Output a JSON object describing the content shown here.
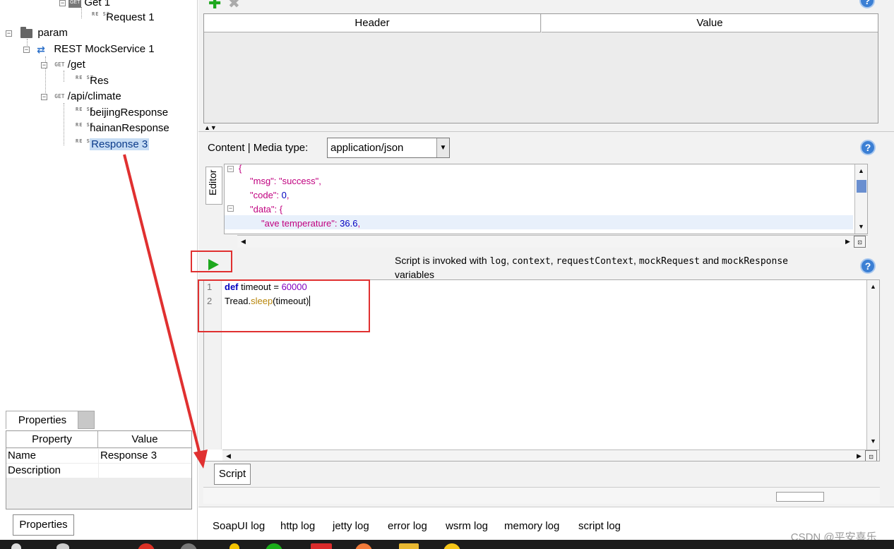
{
  "tree": {
    "get1": "Get 1",
    "request1": "Request 1",
    "param": "param",
    "mock_service": "REST MockService 1",
    "path_get": "/get",
    "res": "Res",
    "path_climate": "/api/climate",
    "beijing": "beijingResponse",
    "hainan": "hainanResponse",
    "response3": "Response 3",
    "get_badge": "GET",
    "rest_badge": "RE ST"
  },
  "properties_panel": {
    "tab_label": "Properties",
    "col_property": "Property",
    "col_value": "Value",
    "rows": [
      {
        "property": "Name",
        "value": "Response 3"
      },
      {
        "property": "Description",
        "value": ""
      }
    ],
    "bottom_button": "Properties"
  },
  "headers_table": {
    "col_header": "Header",
    "col_value": "Value"
  },
  "content": {
    "label": "Content | Media type:",
    "media_type": "application/json",
    "editor_tab": "Editor",
    "json_lines": [
      {
        "text": "{",
        "indent": 0,
        "fold": true
      },
      {
        "key": "\"msg\"",
        "value": "\"success\"",
        "comma": ","
      },
      {
        "key": "\"code\"",
        "value": "0",
        "comma": ","
      },
      {
        "key": "\"data\"",
        "value": "{",
        "comma": ""
      },
      {
        "key": "\"ave temperature\"",
        "value": "36.6",
        "comma": ","
      }
    ]
  },
  "script": {
    "info_prefix": "Script is invoked with",
    "info_vars": [
      "log",
      "context",
      "requestContext",
      "mockRequest"
    ],
    "info_and": "and",
    "info_last": "mockResponse",
    "info_suffix": "variables",
    "line1": {
      "kw": "def",
      "var": "timeout = ",
      "num": "60000"
    },
    "line2": {
      "obj": "Tread.",
      "fn": "sleep",
      "args": "(timeout)"
    },
    "tab_label": "Script"
  },
  "log_tabs": [
    "SoapUI log",
    "http log",
    "jetty log",
    "error log",
    "wsrm log",
    "memory log",
    "script log"
  ],
  "watermark": "CSDN @平安喜乐_",
  "colors": {
    "accent_red": "#e03030",
    "run_green": "#1ea81e",
    "selection_blue": "#c6dcf4"
  }
}
